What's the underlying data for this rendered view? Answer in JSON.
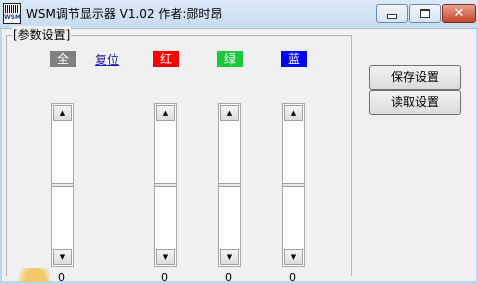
{
  "window": {
    "icon_text": "WSM",
    "title": "WSM调节显示器  V1.02    作者:郧时昂"
  },
  "group": {
    "label": "[参数设置]"
  },
  "channels": [
    {
      "label": "全",
      "color": "#808080",
      "value": "0"
    },
    {
      "label": "红",
      "color": "#ff0000",
      "value": "0"
    },
    {
      "label": "绿",
      "color": "#19c83c",
      "value": "0"
    },
    {
      "label": "蓝",
      "color": "#0000ff",
      "value": "0"
    }
  ],
  "reset_label": "复位",
  "buttons": {
    "save": "保存设置",
    "load": "读取设置"
  },
  "icons": {
    "up": "scroll-up-icon",
    "down": "scroll-down-icon"
  }
}
